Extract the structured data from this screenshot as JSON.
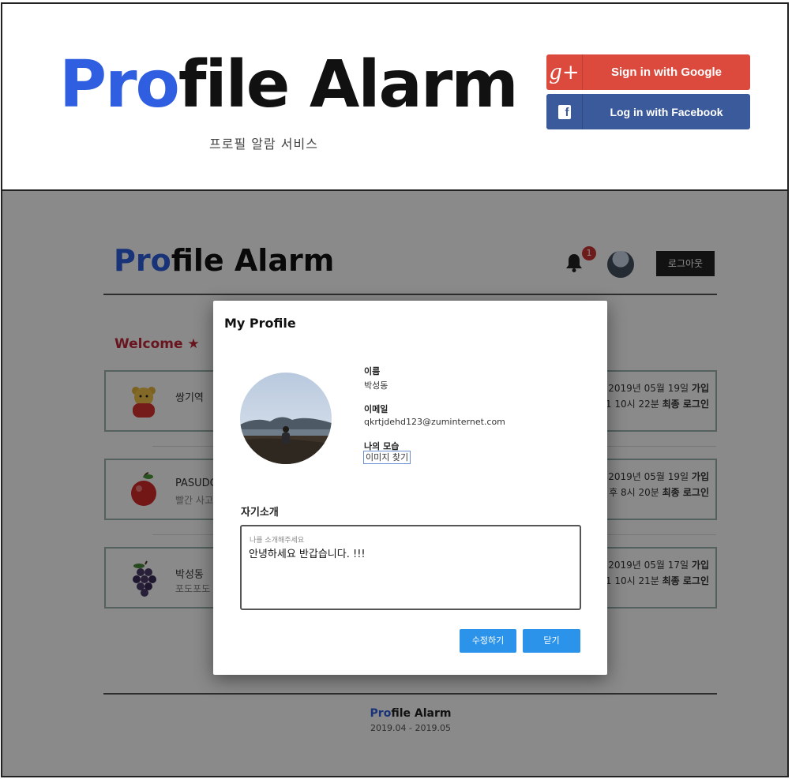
{
  "login_panel": {
    "title_accent": "Pro",
    "title_rest": "file Alarm",
    "subtitle": "프로필 알람 서비스",
    "google_button": {
      "label": "Sign in with Google",
      "icon": "google-plus-icon",
      "color": "#dc4a3d"
    },
    "facebook_button": {
      "label": "Log in with Facebook",
      "icon": "facebook-icon",
      "color": "#3b5a9b"
    }
  },
  "app": {
    "header": {
      "title_accent": "Pro",
      "title_rest": "file Alarm",
      "notification_count": "1",
      "logout_label": "로그아웃"
    },
    "welcome": "Welcome ★",
    "users": [
      {
        "name": "쌍기역",
        "desc": "",
        "icon": "pooh-bear-icon",
        "join": "2019년 05월 19일",
        "join_suffix": "가입",
        "last": "1 10시 22분",
        "last_suffix": "최종 로그인"
      },
      {
        "name": "PASUDO",
        "desc": "빨간 사고",
        "icon": "apple-icon",
        "join": "2019년 05월 19일",
        "join_suffix": "가입",
        "last": "후 8시 20분",
        "last_suffix": "최종 로그인"
      },
      {
        "name": "박성동",
        "desc": "포도포도",
        "icon": "grapes-icon",
        "join": "2019년 05월 17일",
        "join_suffix": "가입",
        "last": "1 10시 21분",
        "last_suffix": "최종 로그인"
      }
    ],
    "footer": {
      "title_accent": "Pro",
      "title_rest": "file Alarm",
      "range": "2019.04 - 2019.05"
    }
  },
  "modal": {
    "title": "My Profile",
    "name_label": "이름",
    "name_value": "박성동",
    "email_label": "이메일",
    "email_value": "qkrtjdehd123@zuminternet.com",
    "image_label": "나의 모습",
    "find_image_button": "이미지 찾기",
    "intro_label": "자기소개",
    "intro_placeholder": "나를 소개해주세요",
    "intro_value": "안녕하세요 반갑습니다. !!!",
    "edit_button": "수정하기",
    "close_button": "닫기"
  },
  "colors": {
    "accent": "#2f5fe0",
    "welcome": "#c0283a",
    "primary_button": "#2b94ea"
  }
}
